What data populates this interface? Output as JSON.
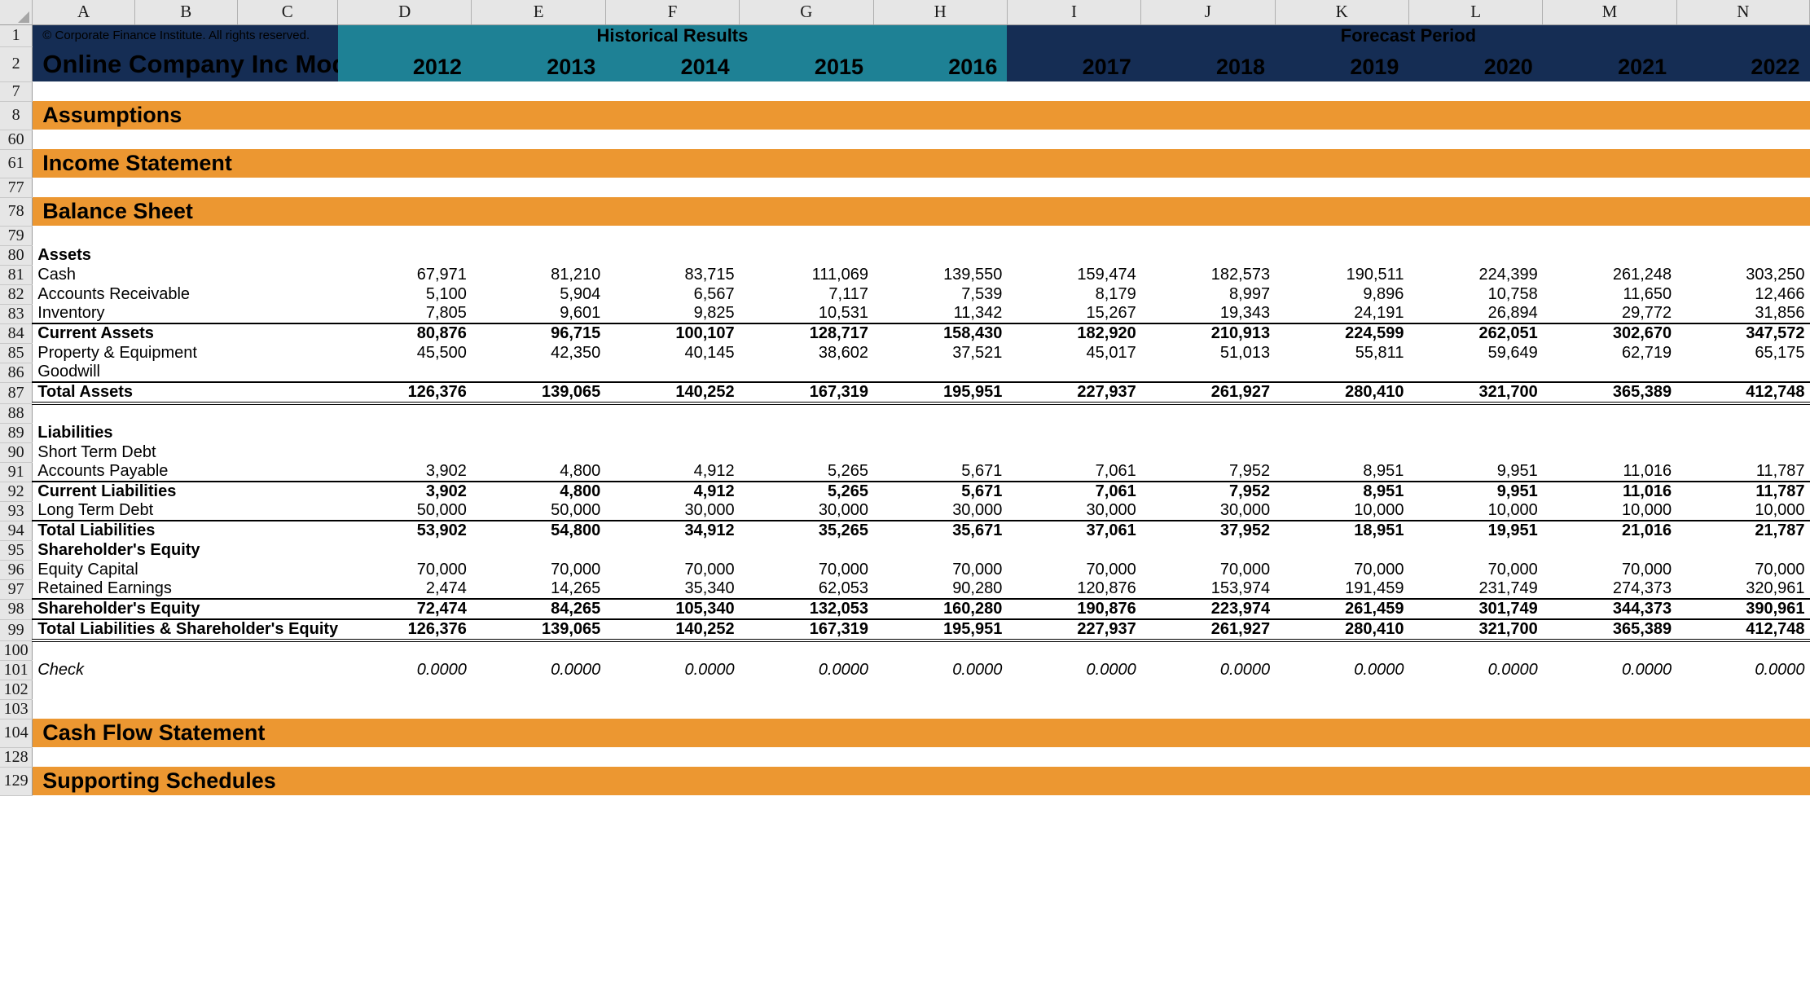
{
  "workbook": {
    "column_letters": [
      "A",
      "B",
      "C",
      "D",
      "E",
      "F",
      "G",
      "H",
      "I",
      "J",
      "K",
      "L",
      "M",
      "N"
    ],
    "copyright": "© Corporate Finance Institute. All rights reserved.",
    "title": "Online Company Inc Model",
    "group_headers": [
      {
        "label": "Historical Results",
        "color": "#1E8195"
      },
      {
        "label": "Forecast Period",
        "color": "#152D54"
      }
    ],
    "years": [
      "2012",
      "2013",
      "2014",
      "2015",
      "2016",
      "2017",
      "2018",
      "2019",
      "2020",
      "2021",
      "2022"
    ],
    "colors": {
      "navy": "#152D54",
      "teal": "#1E8195",
      "orange": "#EC9731",
      "input_blue": "#1818E0",
      "gutter": "#E6E6E6"
    }
  },
  "section_banners": {
    "assumptions": "Assumptions",
    "income_statement": "Income Statement",
    "balance_sheet": "Balance Sheet",
    "cash_flow_statement": "Cash Flow Statement",
    "supporting_schedules": "Supporting Schedules"
  },
  "rows": [
    {
      "n": "7",
      "kind": "blank"
    },
    {
      "n": "8",
      "kind": "banner",
      "label": "Assumptions"
    },
    {
      "n": "60",
      "kind": "blank"
    },
    {
      "n": "61",
      "kind": "banner",
      "label": "Income Statement"
    },
    {
      "n": "77",
      "kind": "blank"
    },
    {
      "n": "78",
      "kind": "banner",
      "label": "Balance Sheet"
    },
    {
      "n": "79",
      "kind": "blank"
    },
    {
      "n": "80",
      "kind": "head",
      "label": "Assets"
    },
    {
      "n": "81",
      "kind": "data",
      "label": "Cash",
      "style": "plain",
      "values": [
        "67,971",
        "81,210",
        "83,715",
        "111,069",
        "139,550",
        "159,474",
        "182,573",
        "190,511",
        "224,399",
        "261,248",
        "303,250"
      ]
    },
    {
      "n": "82",
      "kind": "data",
      "label": "Accounts Receivable",
      "style": "input5",
      "values": [
        "5,100",
        "5,904",
        "6,567",
        "7,117",
        "7,539",
        "8,179",
        "8,997",
        "9,896",
        "10,758",
        "11,650",
        "12,466"
      ]
    },
    {
      "n": "83",
      "kind": "data",
      "label": "Inventory",
      "style": "input5",
      "values": [
        "7,805",
        "9,601",
        "9,825",
        "10,531",
        "11,342",
        "15,267",
        "19,343",
        "24,191",
        "26,894",
        "29,772",
        "31,856"
      ]
    },
    {
      "n": "84",
      "kind": "total",
      "label": "Current Assets",
      "rule": "top",
      "values": [
        "80,876",
        "96,715",
        "100,107",
        "128,717",
        "158,430",
        "182,920",
        "210,913",
        "224,599",
        "262,051",
        "302,670",
        "347,572"
      ]
    },
    {
      "n": "85",
      "kind": "data",
      "label": "Property & Equipment",
      "style": "input5",
      "values": [
        "45,500",
        "42,350",
        "40,145",
        "38,602",
        "37,521",
        "45,017",
        "51,013",
        "55,811",
        "59,649",
        "62,719",
        "65,175"
      ]
    },
    {
      "n": "86",
      "kind": "data",
      "label": "Goodwill",
      "style": "plain",
      "values": [
        "",
        "",
        "",
        "",
        "",
        "",
        "",
        "",
        "",
        "",
        ""
      ]
    },
    {
      "n": "87",
      "kind": "total",
      "label": "Total Assets",
      "rule": "topdbl",
      "values": [
        "126,376",
        "139,065",
        "140,252",
        "167,319",
        "195,951",
        "227,937",
        "261,927",
        "280,410",
        "321,700",
        "365,389",
        "412,748"
      ]
    },
    {
      "n": "88",
      "kind": "blank"
    },
    {
      "n": "89",
      "kind": "head",
      "label": "Liabilities"
    },
    {
      "n": "90",
      "kind": "data",
      "label": "Short Term Debt",
      "style": "plain",
      "values": [
        "",
        "",
        "",
        "",
        "",
        "",
        "",
        "",
        "",
        "",
        ""
      ]
    },
    {
      "n": "91",
      "kind": "data",
      "label": "Accounts Payable",
      "style": "input5",
      "values": [
        "3,902",
        "4,800",
        "4,912",
        "5,265",
        "5,671",
        "7,061",
        "7,952",
        "8,951",
        "9,951",
        "11,016",
        "11,787"
      ]
    },
    {
      "n": "92",
      "kind": "total",
      "label": "Current Liabilities",
      "rule": "top",
      "values": [
        "3,902",
        "4,800",
        "4,912",
        "5,265",
        "5,671",
        "7,061",
        "7,952",
        "8,951",
        "9,951",
        "11,016",
        "11,787"
      ]
    },
    {
      "n": "93",
      "kind": "data",
      "label": "Long Term Debt",
      "style": "input5",
      "values": [
        "50,000",
        "50,000",
        "30,000",
        "30,000",
        "30,000",
        "30,000",
        "30,000",
        "10,000",
        "10,000",
        "10,000",
        "10,000"
      ]
    },
    {
      "n": "94",
      "kind": "total",
      "label": "Total Liabilities",
      "rule": "top",
      "values": [
        "53,902",
        "54,800",
        "34,912",
        "35,265",
        "35,671",
        "37,061",
        "37,952",
        "18,951",
        "19,951",
        "21,016",
        "21,787"
      ]
    },
    {
      "n": "95",
      "kind": "head",
      "label": "Shareholder's Equity"
    },
    {
      "n": "96",
      "kind": "data",
      "label": "Equity Capital",
      "style": "input5",
      "values": [
        "70,000",
        "70,000",
        "70,000",
        "70,000",
        "70,000",
        "70,000",
        "70,000",
        "70,000",
        "70,000",
        "70,000",
        "70,000"
      ]
    },
    {
      "n": "97",
      "kind": "data",
      "label": "Retained Earnings",
      "style": "input5",
      "values": [
        "2,474",
        "14,265",
        "35,340",
        "62,053",
        "90,280",
        "120,876",
        "153,974",
        "191,459",
        "231,749",
        "274,373",
        "320,961"
      ]
    },
    {
      "n": "98",
      "kind": "total",
      "label": "Shareholder's Equity",
      "rule": "top",
      "values": [
        "72,474",
        "84,265",
        "105,340",
        "132,053",
        "160,280",
        "190,876",
        "223,974",
        "261,459",
        "301,749",
        "344,373",
        "390,961"
      ]
    },
    {
      "n": "99",
      "kind": "total",
      "label": "Total Liabilities & Shareholder's Equity",
      "rule": "topdbl",
      "values": [
        "126,376",
        "139,065",
        "140,252",
        "167,319",
        "195,951",
        "227,937",
        "261,927",
        "280,410",
        "321,700",
        "365,389",
        "412,748"
      ]
    },
    {
      "n": "100",
      "kind": "blank"
    },
    {
      "n": "101",
      "kind": "check",
      "label": "Check",
      "values": [
        "0.0000",
        "0.0000",
        "0.0000",
        "0.0000",
        "0.0000",
        "0.0000",
        "0.0000",
        "0.0000",
        "0.0000",
        "0.0000",
        "0.0000"
      ]
    },
    {
      "n": "102",
      "kind": "blank"
    },
    {
      "n": "103",
      "kind": "blank"
    },
    {
      "n": "104",
      "kind": "banner",
      "label": "Cash Flow Statement"
    },
    {
      "n": "128",
      "kind": "blank"
    },
    {
      "n": "129",
      "kind": "banner",
      "label": "Supporting Schedules"
    }
  ]
}
